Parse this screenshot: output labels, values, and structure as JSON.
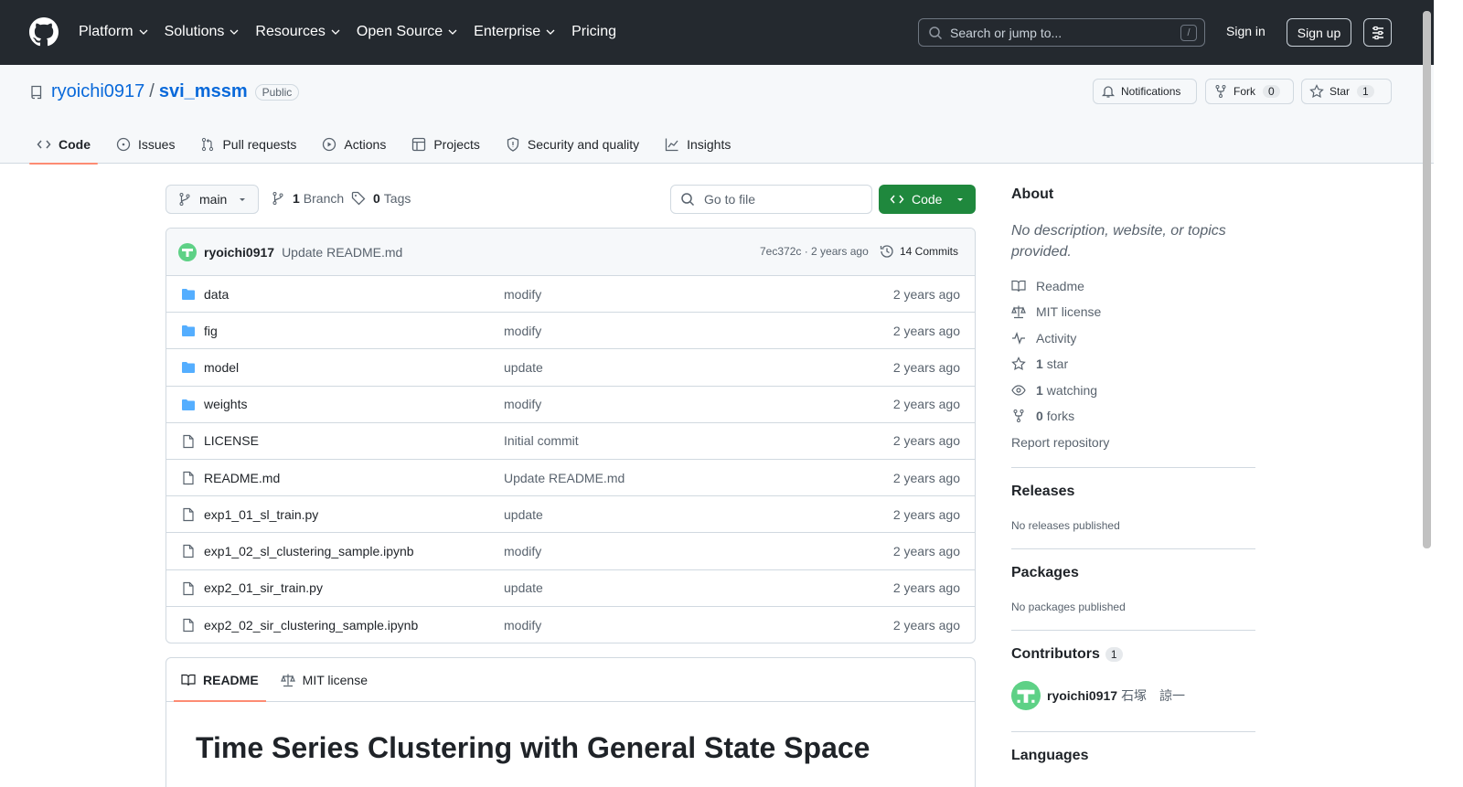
{
  "header": {
    "nav": [
      {
        "label": "Platform",
        "chevron": true
      },
      {
        "label": "Solutions",
        "chevron": true
      },
      {
        "label": "Resources",
        "chevron": true
      },
      {
        "label": "Open Source",
        "chevron": true
      },
      {
        "label": "Enterprise",
        "chevron": true
      },
      {
        "label": "Pricing",
        "chevron": false
      }
    ],
    "search_placeholder": "Search or jump to...",
    "search_shortcut": "/",
    "sign_in": "Sign in",
    "sign_up": "Sign up"
  },
  "repo": {
    "owner": "ryoichi0917",
    "separator": "/",
    "name": "svi_mssm",
    "visibility": "Public",
    "notifications_label": "Notifications",
    "fork_label": "Fork",
    "fork_count": "0",
    "star_label": "Star",
    "star_count": "1",
    "tabs": [
      {
        "label": "Code",
        "icon": "code-icon",
        "active": true
      },
      {
        "label": "Issues",
        "icon": "issue-icon",
        "active": false
      },
      {
        "label": "Pull requests",
        "icon": "pull-request-icon",
        "active": false
      },
      {
        "label": "Actions",
        "icon": "play-icon",
        "active": false
      },
      {
        "label": "Projects",
        "icon": "table-icon",
        "active": false
      },
      {
        "label": "Security and quality",
        "icon": "shield-icon",
        "active": false
      },
      {
        "label": "Insights",
        "icon": "graph-icon",
        "active": false
      }
    ]
  },
  "toolbar": {
    "branch": "main",
    "branch_count": "1",
    "branch_label": "Branch",
    "tag_count": "0",
    "tag_label": "Tags",
    "goto_placeholder": "Go to file",
    "code_button": "Code"
  },
  "last_commit": {
    "author": "ryoichi0917",
    "message": "Update README.md",
    "meta": "7ec372c · 2 years ago",
    "commits": "14 Commits"
  },
  "files": [
    {
      "type": "folder",
      "name": "data",
      "commit": "modify",
      "age": "2 years ago"
    },
    {
      "type": "folder",
      "name": "fig",
      "commit": "modify",
      "age": "2 years ago"
    },
    {
      "type": "folder",
      "name": "model",
      "commit": "update",
      "age": "2 years ago"
    },
    {
      "type": "folder",
      "name": "weights",
      "commit": "modify",
      "age": "2 years ago"
    },
    {
      "type": "file",
      "name": "LICENSE",
      "commit": "Initial commit",
      "age": "2 years ago"
    },
    {
      "type": "file",
      "name": "README.md",
      "commit": "Update README.md",
      "age": "2 years ago"
    },
    {
      "type": "file",
      "name": "exp1_01_sl_train.py",
      "commit": "update",
      "age": "2 years ago"
    },
    {
      "type": "file",
      "name": "exp1_02_sl_clustering_sample.ipynb",
      "commit": "modify",
      "age": "2 years ago"
    },
    {
      "type": "file",
      "name": "exp2_01_sir_train.py",
      "commit": "update",
      "age": "2 years ago"
    },
    {
      "type": "file",
      "name": "exp2_02_sir_clustering_sample.ipynb",
      "commit": "modify",
      "age": "2 years ago"
    }
  ],
  "readme": {
    "tab_readme": "README",
    "tab_license": "MIT license",
    "heading": "Time Series Clustering with General State Space"
  },
  "sidebar": {
    "about_title": "About",
    "about_desc": "No description, website, or topics provided.",
    "readme": "Readme",
    "license": "MIT license",
    "activity": "Activity",
    "stars_count": "1",
    "stars_label": "star",
    "watching_count": "1",
    "watching_label": "watching",
    "forks_count": "0",
    "forks_label": "forks",
    "report": "Report repository",
    "releases_title": "Releases",
    "releases_empty": "No releases published",
    "packages_title": "Packages",
    "packages_empty": "No packages published",
    "contributors_title": "Contributors",
    "contributors_count": "1",
    "contributor_login": "ryoichi0917",
    "contributor_name": "石塚　諒一",
    "languages_title": "Languages"
  },
  "colors": {
    "header_bg": "#24292f",
    "link": "#0969da",
    "primary_button": "#1f883d",
    "active_tab_underline": "#fd8c73",
    "folder_icon": "#54aeff",
    "avatar": "#5ed186"
  }
}
